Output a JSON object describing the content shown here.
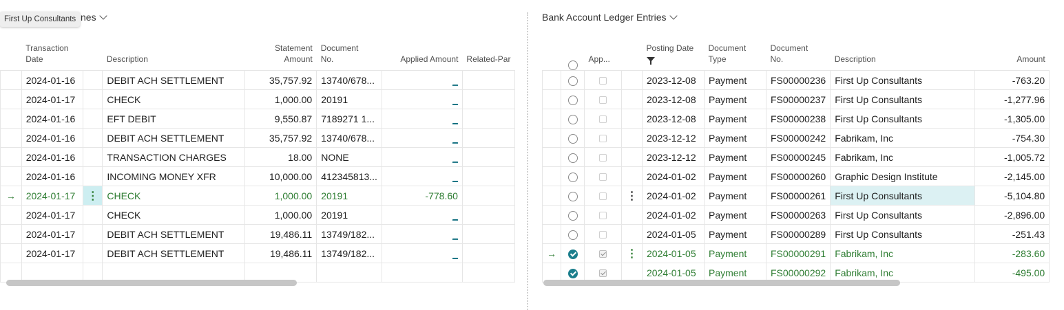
{
  "left": {
    "title_partial": "nes",
    "tooltip": "First Up Consultants",
    "headers": {
      "transaction_date_1": "Transaction",
      "transaction_date_2": "Date",
      "description": "Description",
      "statement_amount_1": "Statement",
      "statement_amount_2": "Amount",
      "document_no_1": "Document",
      "document_no_2": "No.",
      "applied_amount": "Applied Amount",
      "related_party": "Related-Par"
    },
    "rows": [
      {
        "date": "2024-01-16",
        "desc": "DEBIT ACH SETTLEMENT",
        "amount": "35,757.92",
        "doc": "13740/678...",
        "applied": "_"
      },
      {
        "date": "2024-01-17",
        "desc": "CHECK",
        "amount": "1,000.00",
        "doc": "20191",
        "applied": "_"
      },
      {
        "date": "2024-01-16",
        "desc": "EFT DEBIT",
        "amount": "9,550.87",
        "doc": "7189271 1...",
        "applied": "_"
      },
      {
        "date": "2024-01-16",
        "desc": "DEBIT ACH SETTLEMENT",
        "amount": "35,757.92",
        "doc": "13740/678...",
        "applied": "_"
      },
      {
        "date": "2024-01-16",
        "desc": "TRANSACTION CHARGES",
        "amount": "18.00",
        "doc": "NONE",
        "applied": "_"
      },
      {
        "date": "2024-01-16",
        "desc": "INCOMING MONEY XFR",
        "amount": "10,000.00",
        "doc": "412345813...",
        "applied": "_"
      },
      {
        "date": "2024-01-17",
        "desc": "CHECK",
        "amount": "1,000.00",
        "doc": "20191",
        "applied": "-778.60",
        "arrow": "→"
      },
      {
        "date": "2024-01-17",
        "desc": "CHECK",
        "amount": "1,000.00",
        "doc": "20191",
        "applied": "_"
      },
      {
        "date": "2024-01-17",
        "desc": "DEBIT ACH SETTLEMENT",
        "amount": "19,486.11",
        "doc": "13749/182...",
        "applied": "_"
      },
      {
        "date": "2024-01-17",
        "desc": "DEBIT ACH SETTLEMENT",
        "amount": "19,486.11",
        "doc": "13749/182...",
        "applied": "_"
      }
    ]
  },
  "right": {
    "title": "Bank Account Ledger Entries",
    "headers": {
      "applied": "App...",
      "posting_date": "Posting Date",
      "document_type_1": "Document",
      "document_type_2": "Type",
      "document_no_1": "Document",
      "document_no_2": "No.",
      "description": "Description",
      "amount": "Amount"
    },
    "rows": [
      {
        "date": "2023-12-08",
        "type": "Payment",
        "doc": "FS00000236",
        "desc": "First Up Consultants",
        "amount": "-763.20"
      },
      {
        "date": "2023-12-08",
        "type": "Payment",
        "doc": "FS00000237",
        "desc": "First Up Consultants",
        "amount": "-1,277.96"
      },
      {
        "date": "2023-12-08",
        "type": "Payment",
        "doc": "FS00000238",
        "desc": "First Up Consultants",
        "amount": "-1,305.00"
      },
      {
        "date": "2023-12-12",
        "type": "Payment",
        "doc": "FS00000242",
        "desc": "Fabrikam, Inc",
        "amount": "-754.30"
      },
      {
        "date": "2023-12-12",
        "type": "Payment",
        "doc": "FS00000245",
        "desc": "Fabrikam, Inc",
        "amount": "-1,005.72"
      },
      {
        "date": "2024-01-02",
        "type": "Payment",
        "doc": "FS00000260",
        "desc": "Graphic Design Institute",
        "amount": "-2,145.00"
      },
      {
        "date": "2024-01-02",
        "type": "Payment",
        "doc": "FS00000261",
        "desc": "First Up Consultants",
        "amount": "-5,104.80"
      },
      {
        "date": "2024-01-02",
        "type": "Payment",
        "doc": "FS00000263",
        "desc": "First Up Consultants",
        "amount": "-2,896.00"
      },
      {
        "date": "2024-01-05",
        "type": "Payment",
        "doc": "FS00000289",
        "desc": "First Up Consultants",
        "amount": "-251.43"
      },
      {
        "date": "2024-01-05",
        "type": "Payment",
        "doc": "FS00000291",
        "desc": "Fabrikam, Inc",
        "amount": "-283.60",
        "arrow": "→"
      },
      {
        "date": "2024-01-05",
        "type": "Payment",
        "doc": "FS00000292",
        "desc": "Fabrikam, Inc",
        "amount": "-495.00"
      }
    ]
  },
  "icons": {
    "row_menu": "⋮",
    "filter": "filter-icon",
    "chevron": "chevron-down-icon"
  },
  "colors": {
    "accent": "#1b7e8c",
    "selected_text": "#2e7d32",
    "active_cell": "#dcf1f3"
  }
}
